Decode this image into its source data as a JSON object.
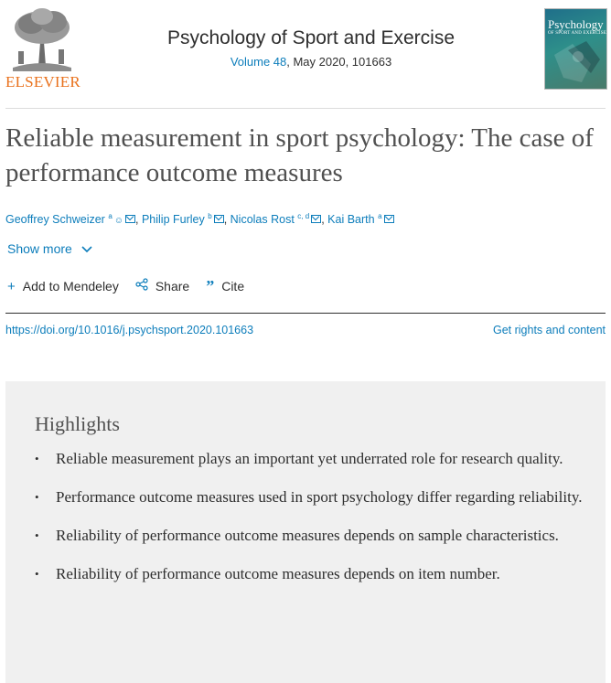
{
  "publisher": {
    "logo_text": "ELSEVIER"
  },
  "journal": {
    "title": "Psychology of Sport and Exercise",
    "volume_link": "Volume 48",
    "issue_info": ", May 2020, 101663"
  },
  "cover": {
    "title": "Psychology",
    "subtitle": "OF SPORT AND EXERCISE"
  },
  "article": {
    "title": "Reliable measurement in sport psychology: The case of performance outcome measures",
    "authors": [
      {
        "name": "Geoffrey Schweizer",
        "sup": "a"
      },
      {
        "name": "Philip Furley",
        "sup": "b"
      },
      {
        "name": "Nicolas Rost",
        "sup": "c, d"
      },
      {
        "name": "Kai Barth",
        "sup": "a"
      }
    ]
  },
  "toolbar": {
    "show_more": "Show more",
    "add_to_mendeley": "Add to Mendeley",
    "share": "Share",
    "cite": "Cite"
  },
  "links": {
    "doi": "https://doi.org/10.1016/j.psychsport.2020.101663",
    "rights": "Get rights and content"
  },
  "highlights": {
    "title": "Highlights",
    "items": [
      "Reliable measurement plays an important yet underrated role for research quality.",
      "Performance outcome measures used in sport psychology differ regarding reliability.",
      "Reliability of performance outcome measures depends on sample characteristics.",
      "Reliability of performance outcome measures depends on item number."
    ]
  },
  "colors": {
    "link": "#0c7dbb",
    "publisher_orange": "#e9711c",
    "highlights_bg": "#f0f0f0"
  }
}
